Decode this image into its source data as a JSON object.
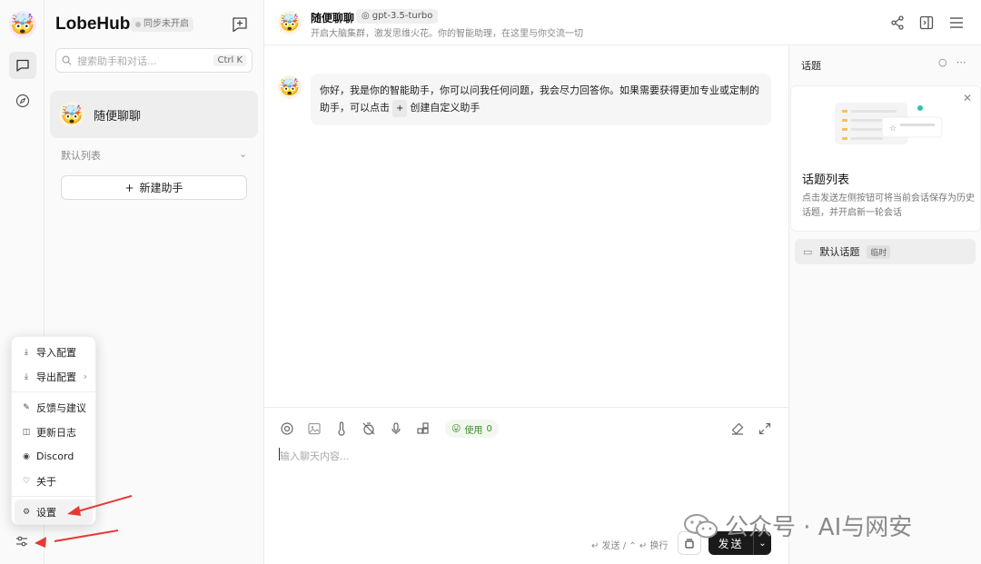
{
  "app": {
    "brand": "LobeHub",
    "sync_status": "同步未开启"
  },
  "sessions": {
    "search_placeholder": "搜索助手和对话...",
    "search_shortcut": "Ctrl K",
    "items": [
      {
        "emoji": "🤯",
        "title": "随便聊聊"
      }
    ],
    "group_label": "默认列表",
    "new_assistant_label": "新建助手"
  },
  "menu": {
    "items": [
      {
        "label": "导入配置",
        "icon": "import-icon"
      },
      {
        "label": "导出配置",
        "icon": "export-icon",
        "has_submenu": true
      },
      {
        "label": "反馈与建议",
        "icon": "feedback-icon"
      },
      {
        "label": "更新日志",
        "icon": "changelog-icon"
      },
      {
        "label": "Discord",
        "icon": "discord-icon"
      },
      {
        "label": "关于",
        "icon": "heart-icon"
      },
      {
        "label": "设置",
        "icon": "settings-icon",
        "active": true
      }
    ]
  },
  "header": {
    "title": "随便聊聊",
    "model": "gpt-3.5-turbo",
    "description": "开启大脑集群，激发思维火花。你的智能助理，在这里与你交流一切"
  },
  "chat": {
    "messages": [
      {
        "role": "assistant",
        "text_before": "你好，我是你的智能助手，你可以问我任何问题，我会尽力回答你。如果需要获得更加专业或定制的助手，可以点击",
        "chip": "+",
        "text_after": "创建自定义助手"
      }
    ]
  },
  "input": {
    "placeholder": "输入聊天内容...",
    "use_chip_label": "使用",
    "use_chip_count": "0",
    "hint": "↵ 发送 / ⌃ ↵ 换行",
    "send_label": "发送"
  },
  "topics": {
    "title": "话题",
    "card_title": "话题列表",
    "card_desc": "点击发送左侧按钮可将当前会话保存为历史话题，并开启新一轮会话",
    "default_topic": "默认话题",
    "default_topic_badge": "临时"
  },
  "watermark": {
    "text": "公众号 · AI与网安"
  },
  "colors": {
    "accent": "#1a1a1a",
    "arrow": "#e53935",
    "use_chip": "#3d8a2f"
  }
}
